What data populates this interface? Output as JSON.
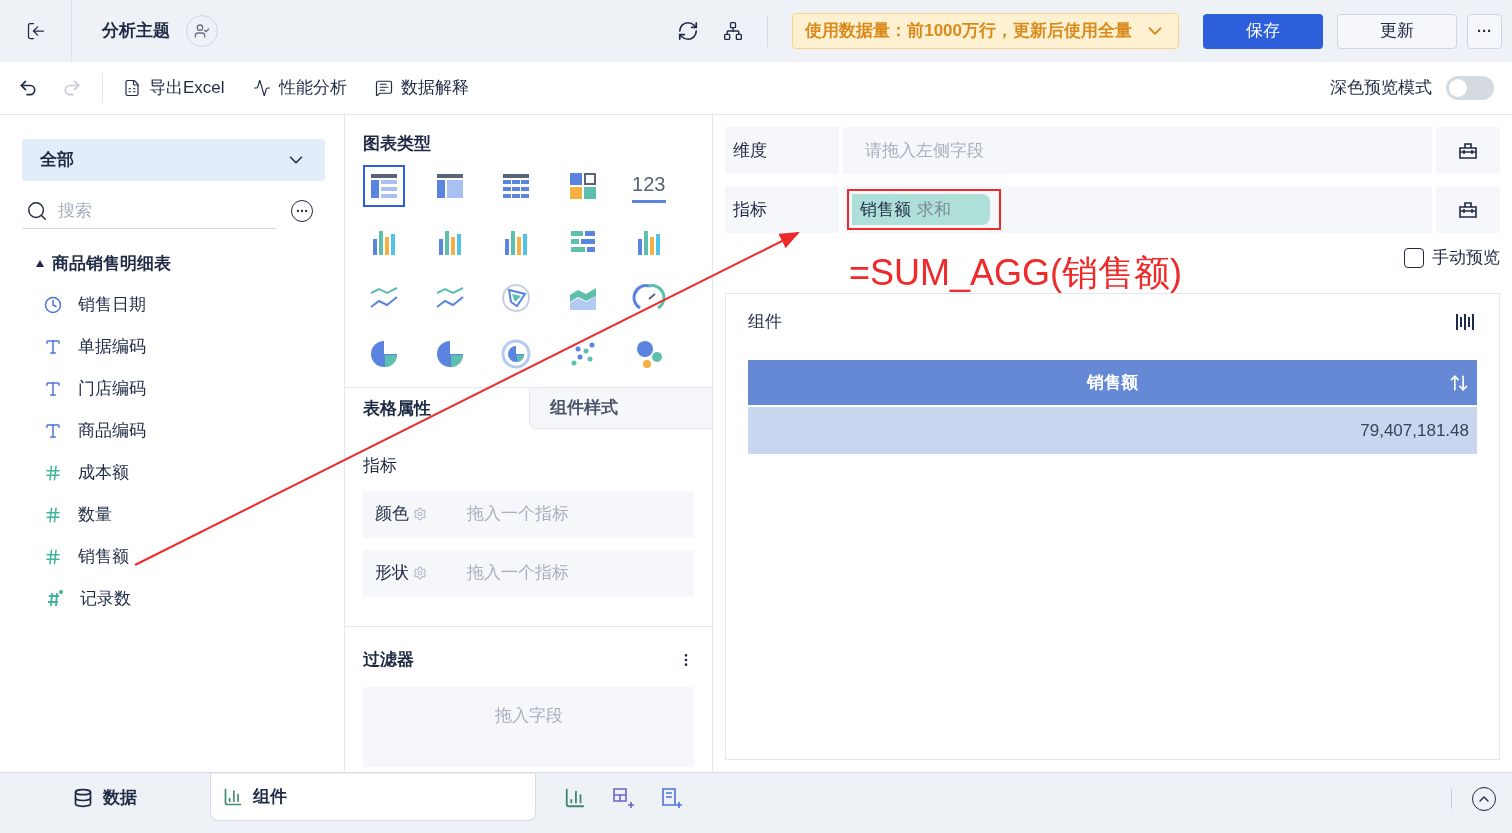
{
  "header": {
    "title": "分析主题",
    "data_notice": "使用数据量：前1000万行，更新后使用全量",
    "save": "保存",
    "update": "更新",
    "more": "···"
  },
  "toolbar": {
    "items": [
      {
        "kind": "excel",
        "label": "导出Excel"
      },
      {
        "kind": "perf",
        "label": "性能分析"
      },
      {
        "kind": "explain",
        "label": "数据解释"
      }
    ],
    "dark_mode": {
      "label": "深色预览模式",
      "on": false
    }
  },
  "fields": {
    "dropdown": "全部",
    "search_placeholder": "搜索",
    "table": {
      "name": "商品销售明细表",
      "expanded": true,
      "children": [
        {
          "kind": "time",
          "label": "销售日期"
        },
        {
          "kind": "text",
          "label": "单据编码"
        },
        {
          "kind": "text",
          "label": "门店编码"
        },
        {
          "kind": "text",
          "label": "商品编码"
        },
        {
          "kind": "number",
          "label": "成本额"
        },
        {
          "kind": "number",
          "label": "数量"
        },
        {
          "kind": "number",
          "label": "销售额"
        },
        {
          "kind": "calc",
          "label": "记录数"
        }
      ]
    }
  },
  "chart_types": {
    "title": "图表类型",
    "items": [
      {
        "kind": "table",
        "selected": true
      },
      {
        "kind": "crosstable",
        "selected": false
      },
      {
        "kind": "detail",
        "selected": false
      },
      {
        "kind": "kpi",
        "selected": false
      },
      {
        "kind": "number",
        "text": "123",
        "selected": false
      },
      {
        "kind": "bar",
        "selected": false
      },
      {
        "kind": "bar",
        "selected": false
      },
      {
        "kind": "bar",
        "selected": false
      },
      {
        "kind": "hbar",
        "selected": false
      },
      {
        "kind": "bar",
        "selected": false
      },
      {
        "kind": "line",
        "selected": false
      },
      {
        "kind": "line",
        "selected": false
      },
      {
        "kind": "radar",
        "selected": false
      },
      {
        "kind": "area",
        "selected": false
      },
      {
        "kind": "gauge",
        "selected": false
      },
      {
        "kind": "pie",
        "selected": false
      },
      {
        "kind": "pie",
        "selected": false
      },
      {
        "kind": "ring",
        "selected": false
      },
      {
        "kind": "scatter",
        "selected": false
      },
      {
        "kind": "bubble",
        "selected": false
      }
    ]
  },
  "props_tabs": [
    {
      "label": "表格属性",
      "selected": true
    },
    {
      "label": "组件样式",
      "selected": false
    }
  ],
  "props": {
    "section": "指标",
    "slots": [
      {
        "label": "颜色",
        "placeholder": "拖入一个指标"
      },
      {
        "label": "形状",
        "placeholder": "拖入一个指标"
      }
    ]
  },
  "filter": {
    "title": "过滤器",
    "placeholder": "拖入字段"
  },
  "shelves": [
    {
      "label": "维度",
      "placeholder": "请拖入左侧字段"
    },
    {
      "label": "指标",
      "chip": {
        "name": "销售额",
        "agg": "求和"
      }
    }
  ],
  "annotation": "=SUM_AGG(销售额)",
  "manual_preview": {
    "label": "手动预览",
    "checked": false
  },
  "widget": {
    "title": "组件",
    "table": {
      "columns": [
        "销售额"
      ],
      "rows": [
        [
          "79,407,181.48"
        ]
      ]
    }
  },
  "bottom_tabs": [
    {
      "kind": "data",
      "label": "数据",
      "selected": false
    },
    {
      "kind": "widget",
      "label": "组件",
      "selected": true
    }
  ]
}
